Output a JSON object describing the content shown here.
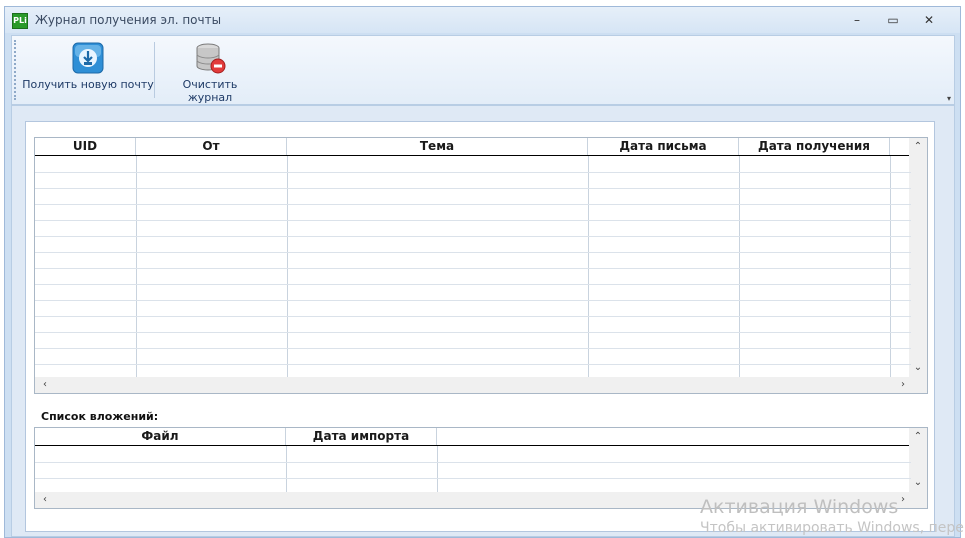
{
  "window": {
    "title": "Журнал получения эл. почты",
    "icon_text": "PLi",
    "minimize_glyph": "–",
    "maximize_glyph": "▭",
    "close_glyph": "✕"
  },
  "ribbon": {
    "get_mail_label": "Получить новую почту",
    "clear_log_label": "Очистить журнал",
    "get_mail_icon": "mail-download-icon",
    "clear_log_icon": "database-delete-icon",
    "menu_glyph": "▾"
  },
  "mail_grid": {
    "columns": [
      "UID",
      "От",
      "Тема",
      "Дата письма",
      "Дата получения"
    ],
    "rows": []
  },
  "attachments": {
    "label": "Список вложений:",
    "columns": [
      "Файл",
      "Дата импорта"
    ],
    "rows": []
  },
  "scroll": {
    "up": "⌃",
    "down": "⌄",
    "left": "‹",
    "right": "›"
  },
  "watermark": {
    "title": "Активация Windows",
    "subtitle": "Чтобы активировать Windows, перейд"
  },
  "colors": {
    "accent": "#2a9a2a",
    "frame": "#cddff2"
  }
}
